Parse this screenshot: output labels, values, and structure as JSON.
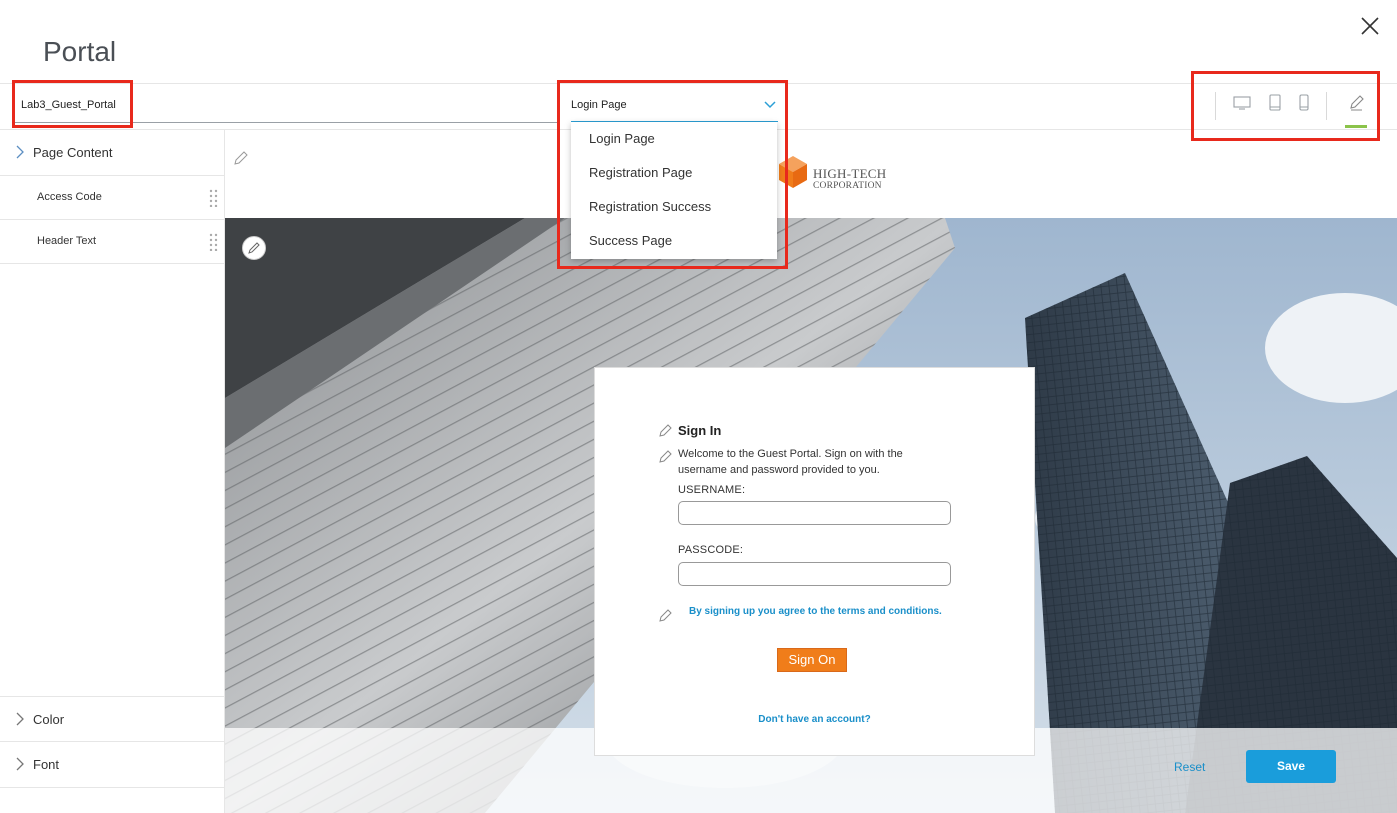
{
  "page": {
    "title": "Portal"
  },
  "portal": {
    "name": "Lab3_Guest_Portal"
  },
  "page_select": {
    "value": "Login Page",
    "options": [
      "Login Page",
      "Registration Page",
      "Registration Success",
      "Success Page"
    ]
  },
  "sidebar": {
    "page_content": "Page Content",
    "items": [
      {
        "label": "Access Code"
      },
      {
        "label": "Header Text"
      }
    ],
    "color": "Color",
    "font": "Font"
  },
  "header": {
    "logo_main": "HIGH-TECH",
    "logo_sub": "CORPORATION"
  },
  "signin": {
    "title": "Sign In",
    "welcome": "Welcome to the Guest Portal. Sign on with the username and password provided to you.",
    "username_label": "USERNAME:",
    "passcode_label": "PASSCODE:",
    "terms": "By signing up you agree to the terms and conditions.",
    "sign_on": "Sign On",
    "no_account": "Don't have an account?"
  },
  "footer": {
    "reset": "Reset",
    "save": "Save"
  },
  "colors": {
    "accent": "#1a9ddb",
    "sign_on": "#f07d1a",
    "highlight": "#e8291c",
    "active": "#8bc34a"
  }
}
